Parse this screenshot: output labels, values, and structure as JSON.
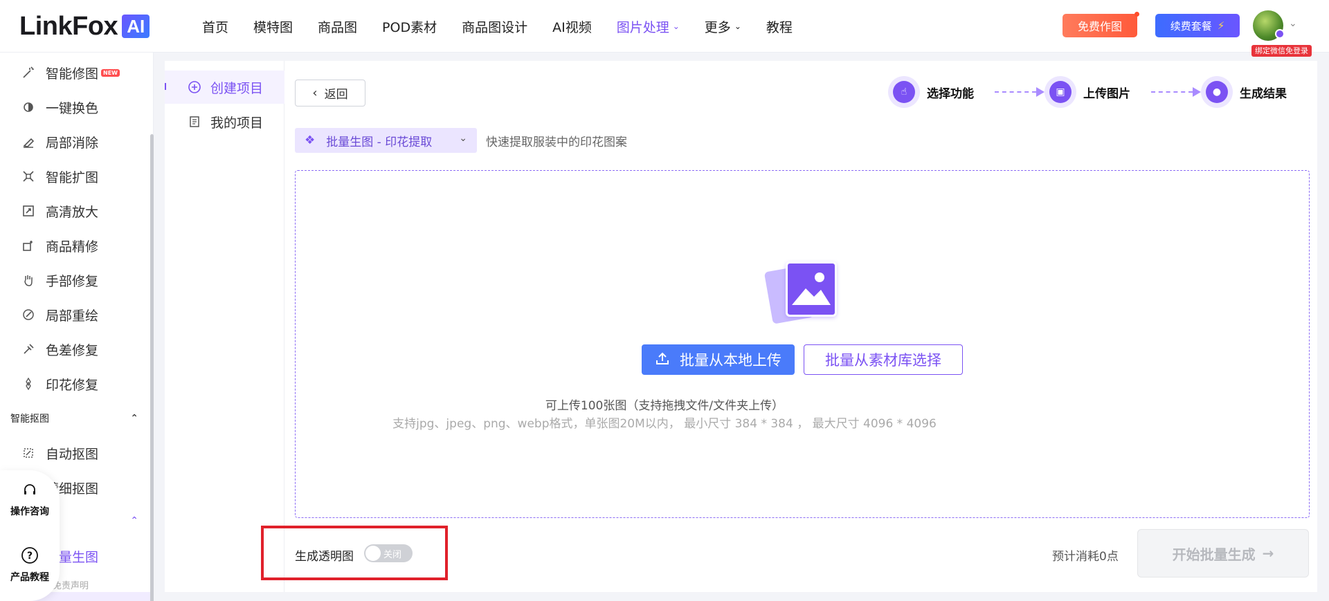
{
  "brand": {
    "logo_text": "LinkFox",
    "logo_ai": "AI"
  },
  "nav": {
    "items": [
      "首页",
      "模特图",
      "商品图",
      "POD素材",
      "商品图设计",
      "AI视频",
      "图片处理",
      "更多",
      "教程"
    ],
    "active": "图片处理"
  },
  "header": {
    "free_btn": "免费作图",
    "vip_btn": "续费套餐",
    "vip_icon": "⚡",
    "wechat_tag": "绑定微信免登录"
  },
  "sidebar": {
    "items": [
      {
        "label": "智能修图",
        "icon": "magic-wand-icon",
        "badge": "NEW"
      },
      {
        "label": "一键换色",
        "icon": "color-swap-icon"
      },
      {
        "label": "局部消除",
        "icon": "eraser-icon"
      },
      {
        "label": "智能扩图",
        "icon": "expand-icon"
      },
      {
        "label": "高清放大",
        "icon": "upscale-icon"
      },
      {
        "label": "商品精修",
        "icon": "product-retouch-icon"
      },
      {
        "label": "手部修复",
        "icon": "hand-icon"
      },
      {
        "label": "局部重绘",
        "icon": "brush-icon"
      },
      {
        "label": "色差修复",
        "icon": "color-fix-icon"
      },
      {
        "label": "印花修复",
        "icon": "print-fix-icon"
      }
    ],
    "group_matting": "智能抠图",
    "matting_items": [
      {
        "label": "自动抠图",
        "icon": "auto-matting-icon"
      },
      {
        "label": "精细抠图",
        "icon": "fine-matting-icon"
      }
    ],
    "active_item": "批量生图",
    "disclaimer": "免责声明"
  },
  "float_help": {
    "consult": "操作咨询",
    "tutorial": "产品教程"
  },
  "subpanel": {
    "create": "创建项目",
    "mine": "我的项目"
  },
  "main": {
    "back": "返回",
    "steps": [
      "选择功能",
      "上传图片",
      "生成结果"
    ],
    "function": "批量生图 - 印花提取",
    "function_desc": "快速提取服装中的印花图案",
    "upload_local": "批量从本地上传",
    "upload_lib": "批量从素材库选择",
    "hint1": "可上传100张图（支持拖拽文件/文件夹上传）",
    "hint2": "支持jpg、jpeg、png、webp格式，单张图20M以内， 最小尺寸 384 * 384 ， 最大尺寸 4096 * 4096",
    "transparent_label": "生成透明图",
    "toggle_state": "关闭",
    "cost": "预计消耗0点",
    "start": "开始批量生成",
    "start_arrow": "→"
  },
  "colors": {
    "accent": "#7b52f3",
    "upload_blue": "#4a7bfa",
    "highlight_red": "#e0212b"
  }
}
